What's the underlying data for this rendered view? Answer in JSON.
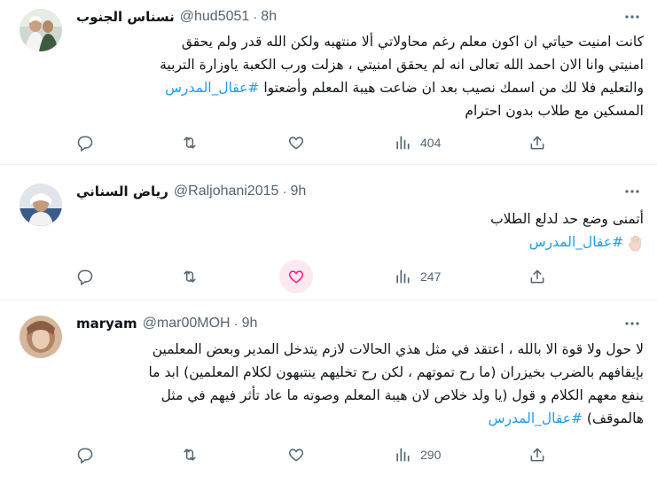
{
  "tweets": [
    {
      "name": "نسناس الجنوب",
      "handle": "@hud5051",
      "time": "8h",
      "lines": [
        "كانت امنيت حياتي ان اكون معلم رغم محاولاتي ألا منتهبه ولكن الله قدر ولم يحقق",
        "امنيتي وانا الان احمد الله تعالى انه لم يحقق امنيتي ، هزلت ورب الكعبة ياوزارة التربية",
        "والتعليم فلا لك من اسمك نصيب بعد ان ضاعت هيبة المعلم وأضعتوا",
        "المسكين مع طلاب بدون احترام"
      ],
      "hashtag": "#عقال_المدرس",
      "views": "404"
    },
    {
      "name": "رياض السناني",
      "handle": "@Raljohani2015",
      "time": "9h",
      "lines": [
        "أتمنى وضع حد لدلع الطلاب"
      ],
      "hashtag": "#عقال_المدرس",
      "views": "247"
    },
    {
      "name": "maryam",
      "handle": "@mar00MOH",
      "time": "9h",
      "lines": [
        "لا حول ولا قوة الا بالله ، اعتقد في مثل هذي الحالات لازم يتدخل المدير وبعض المعلمين",
        "بإيقافهم بالضرب بخيزران (ما رح تموتهم ، لكن رح تخليهم ينتبهون لكلام المعلمين) ابد ما",
        "ينفع معهم الكلام و قول (يا ولد خلاص لان هيبة المعلم وصوته ما عاد تأثر فيهم في مثل",
        "هالموقف)"
      ],
      "hashtag": "#عقال_المدرس",
      "views": "290"
    }
  ],
  "icons": {
    "more": "more-dots-icon",
    "reply": "reply-icon",
    "retweet": "retweet-icon",
    "like": "like-heart-icon",
    "views": "views-chart-icon",
    "share": "share-icon"
  },
  "colors": {
    "hashtag": "#1d9bf0",
    "secondary_text": "#536471",
    "like_highlight": "#f91880"
  }
}
